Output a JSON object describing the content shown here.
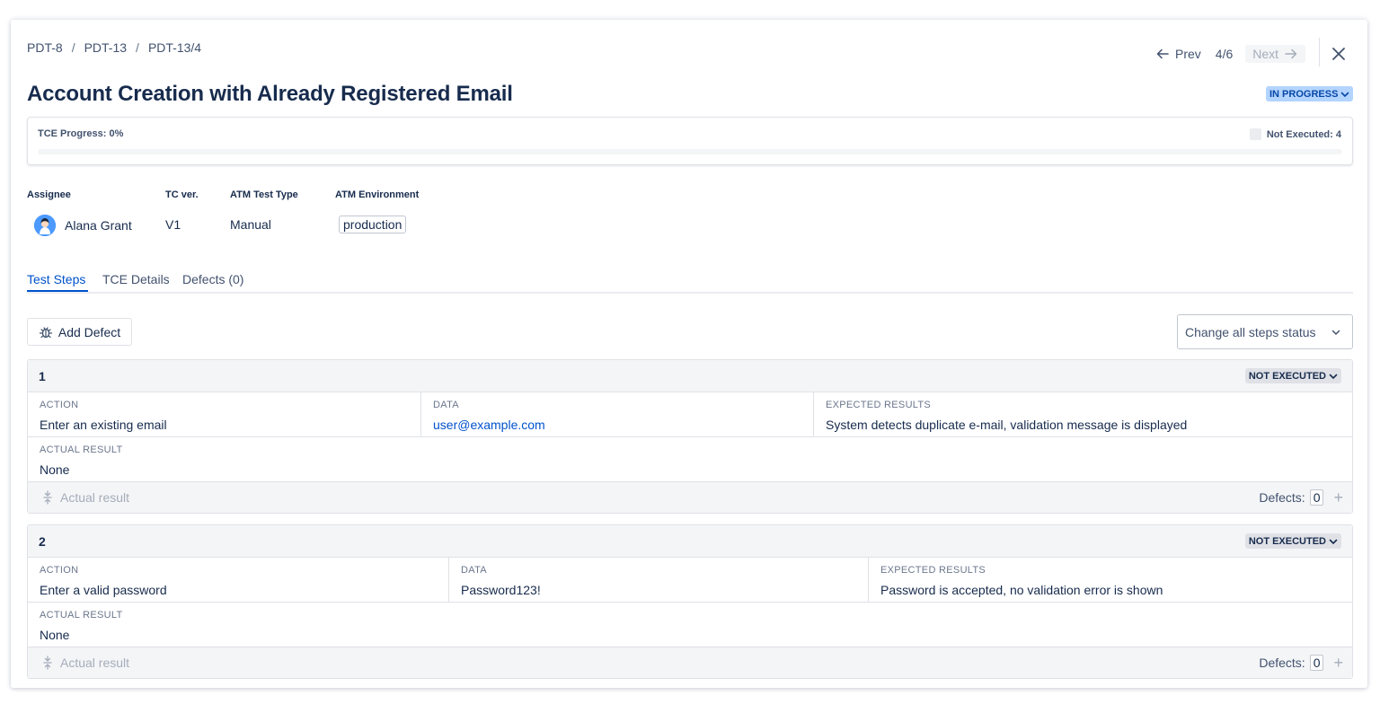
{
  "breadcrumb": [
    "PDT-8",
    "PDT-13",
    "PDT-13/4"
  ],
  "nav": {
    "prev": "Prev",
    "count": "4/6",
    "next": "Next"
  },
  "title": "Account Creation with Already Registered Email",
  "status": "IN PROGRESS",
  "progress": {
    "label": "TCE Progress: 0%",
    "value": 0,
    "legend": "Not Executed: 4"
  },
  "fields": {
    "assignee_label": "Assignee",
    "assignee": "Alana Grant",
    "tc_ver_label": "TC ver.",
    "tc_ver": "V1",
    "test_type_label": "ATM Test Type",
    "test_type": "Manual",
    "environment_label": "ATM Environment",
    "environment": "production"
  },
  "tabs": [
    "Test Steps",
    "TCE Details",
    "Defects (0)"
  ],
  "buttons": {
    "add_defect": "Add Defect",
    "change_status": "Change all steps status"
  },
  "columns": {
    "action": "ACTION",
    "data": "DATA",
    "expected": "EXPECTED RESULTS",
    "actual": "ACTUAL RESULT"
  },
  "steps": [
    {
      "num": "1",
      "status": "NOT EXECUTED",
      "action": "Enter an existing email",
      "data": "user@example.com",
      "expected": "System detects duplicate e-mail, validation message is displayed",
      "actual": "None",
      "actual_button": "Actual result",
      "defects_label": "Defects:",
      "defects_count": "0"
    },
    {
      "num": "2",
      "status": "NOT EXECUTED",
      "action": "Enter a valid password",
      "data": "Password123!",
      "expected": "Password is accepted, no validation error is shown",
      "actual": "None",
      "actual_button": "Actual result",
      "defects_label": "Defects:",
      "defects_count": "0"
    }
  ],
  "colors": {
    "accent": "#0052cc",
    "status_bg": "#b3d4ff",
    "text": "#172b4d"
  }
}
